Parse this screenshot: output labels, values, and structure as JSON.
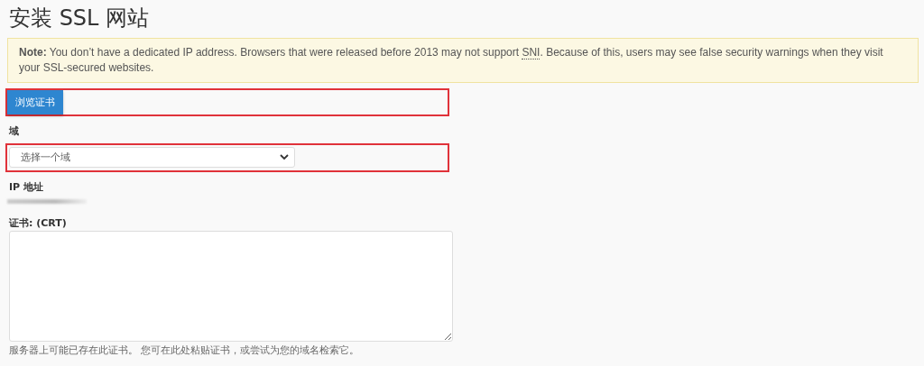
{
  "title": "安装 SSL 网站",
  "note": {
    "label": "Note:",
    "text_before": "You don’t have a dedicated IP address. Browsers that were released before 2013 may not support",
    "abbr": "SNI",
    "text_after": ". Because of this, users may see false security warnings when they visit your SSL-secured websites."
  },
  "browse_button": {
    "label": "浏览证书",
    "highlighted": true
  },
  "domain": {
    "label": "域",
    "value": "选择一个域",
    "highlighted": true
  },
  "ip": {
    "label": "IP 地址",
    "redacted": true
  },
  "certificate": {
    "label": "证书: (CRT)",
    "help": "服务器上可能已存在此证书。 您可在此处粘贴证书，或尝试为您的域名检索它。"
  }
}
